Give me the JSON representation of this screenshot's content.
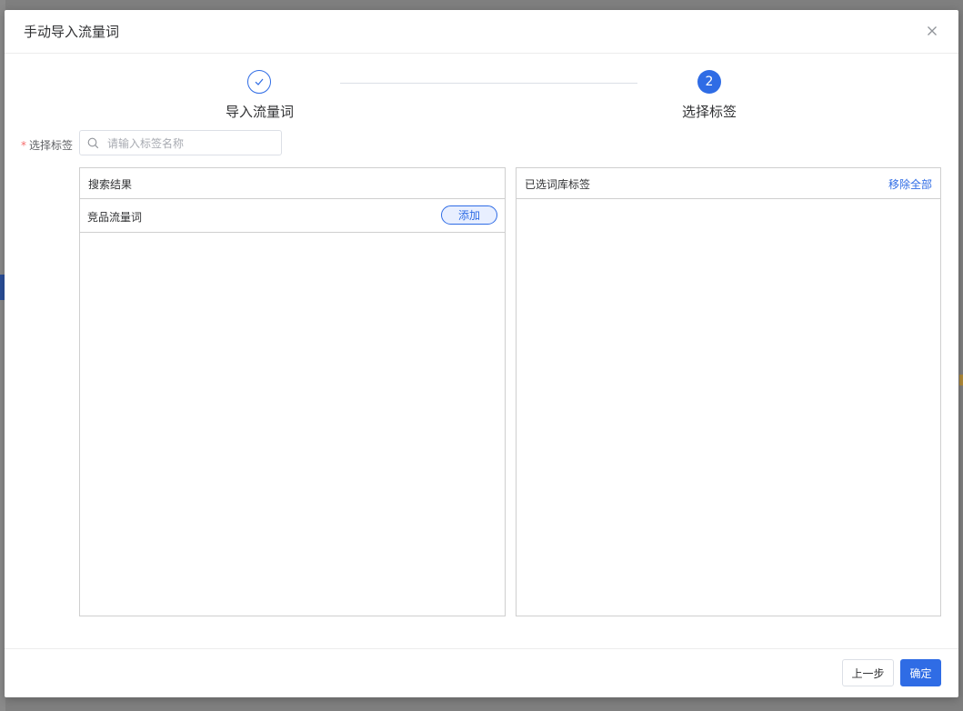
{
  "dialog": {
    "title": "手动导入流量词"
  },
  "steps": [
    {
      "label": "导入流量词",
      "status": "done"
    },
    {
      "label": "选择标签",
      "status": "active",
      "number": "2"
    }
  ],
  "form": {
    "label": "选择标签",
    "required_mark": "*",
    "search_placeholder": "请输入标签名称",
    "search_value": ""
  },
  "left_panel": {
    "header": "搜索结果",
    "items": [
      {
        "label": "竞品流量词",
        "action": "添加"
      }
    ]
  },
  "right_panel": {
    "header": "已选词库标签",
    "remove_all": "移除全部"
  },
  "footer": {
    "prev_label": "上一步",
    "confirm_label": "确定"
  },
  "colors": {
    "primary": "#2f6ce5",
    "overlay": "#7f7f7f",
    "border": "#cfcfcf",
    "required": "#f56c6c"
  }
}
